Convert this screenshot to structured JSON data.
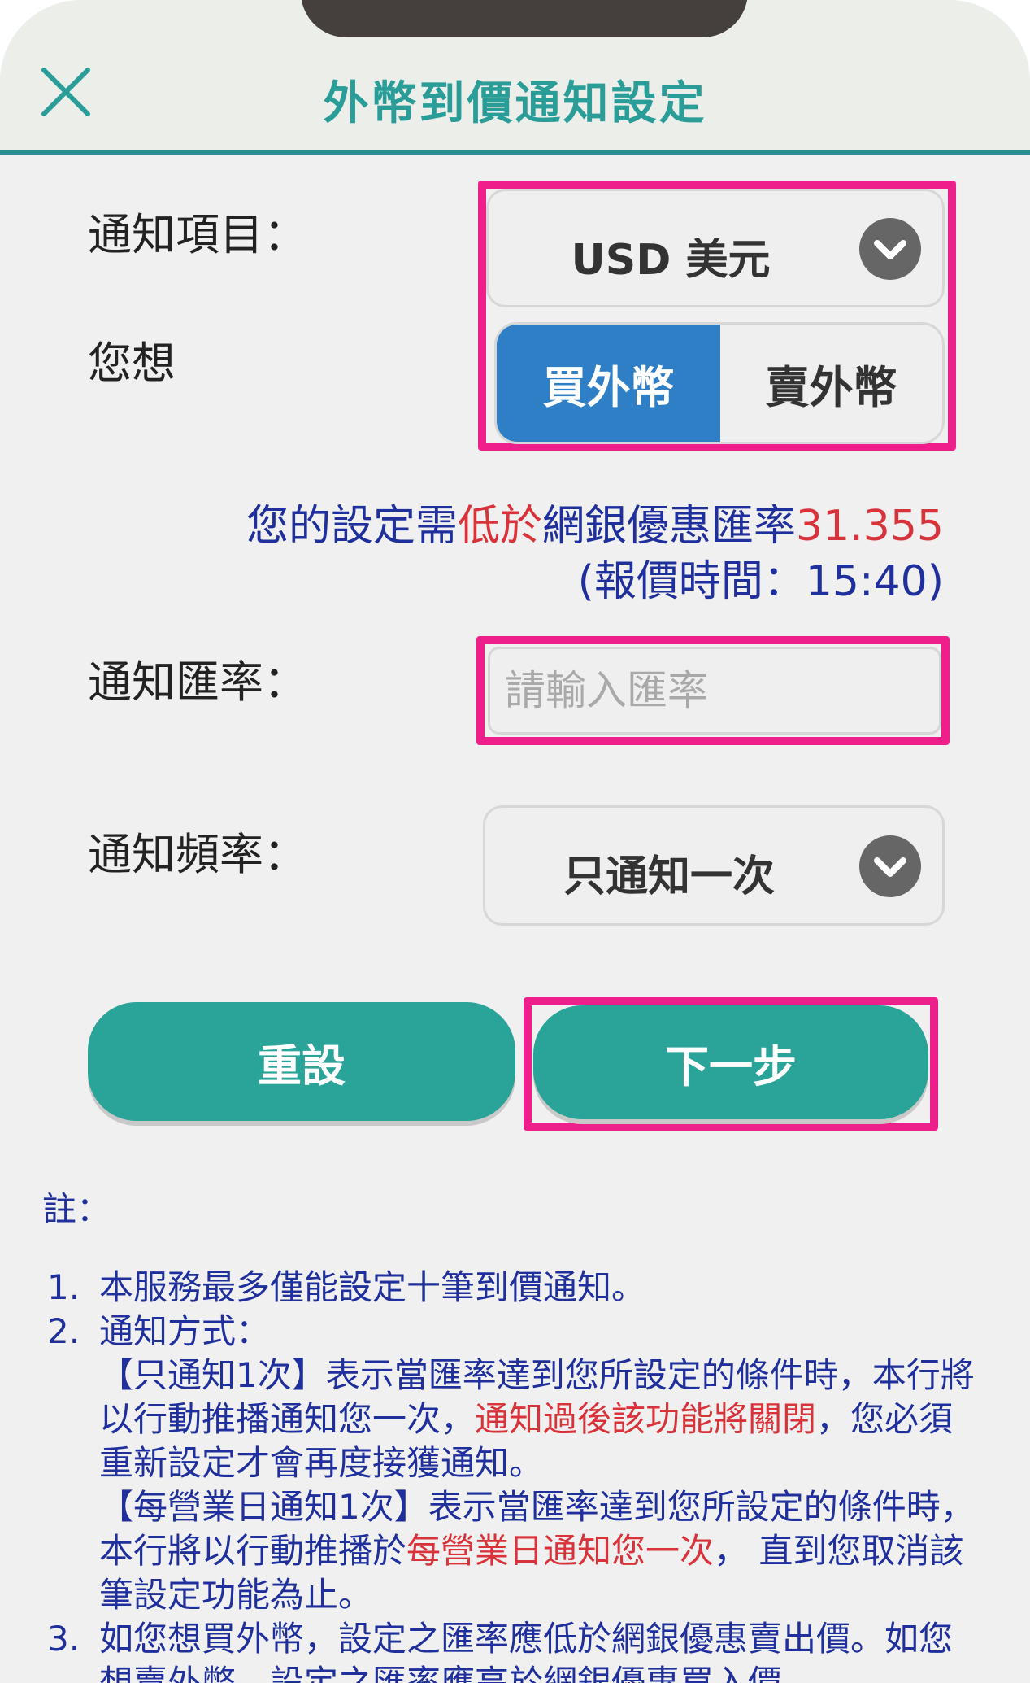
{
  "header": {
    "title": "外幣到價通知設定"
  },
  "form": {
    "item_label": "通知項目：",
    "currency_value": "USD 美元",
    "direction_label": "您想",
    "buy_label": "買外幣",
    "sell_label": "賣外幣",
    "info_line1_prefix": "您的設定需",
    "info_line1_red": "低於",
    "info_line1_mid": "網銀優惠匯率",
    "info_rate": "31.355",
    "info_line2": "(報價時間：15:40)",
    "rate_label": "通知匯率：",
    "rate_placeholder": "請輸入匯率",
    "freq_label": "通知頻率：",
    "freq_value": "只通知一次",
    "reset_label": "重設",
    "next_label": "下一步"
  },
  "notes": {
    "heading": "註：",
    "n1_num": "1.",
    "n1_text": "本服務最多僅能設定十筆到價通知。",
    "n2_num": "2.",
    "n2_title": "通知方式：",
    "n2_p1_a": "【只通知1次】表示當匯率達到您所設定的條件時，本行將以行動推播通知您一次，",
    "n2_p1_red": "通知過後該功能將關閉",
    "n2_p1_b": "，您必須重新設定才會再度接獲通知。",
    "n2_p2_a": "【每營業日通知1次】表示當匯率達到您所設定的條件時，本行將以行動推播於",
    "n2_p2_red": "每營業日通知您一次",
    "n2_p2_b": "， 直到您取消該筆設定功能為止。",
    "n3_num": "3.",
    "n3_text": "如您想買外幣，設定之匯率應低於網銀優惠賣出價。如您想賣外幣，設定之匯率應高於網銀優惠買入價。"
  },
  "colors": {
    "accent": "#2aa399",
    "title": "#2a9d98",
    "highlight": "#ee1f8a",
    "segment_active": "#2f7fc6",
    "note_text": "#1f2f9c",
    "warning_red": "#d8333a"
  },
  "icons": {
    "close": "close-icon",
    "dropdown": "chevron-down-icon"
  }
}
